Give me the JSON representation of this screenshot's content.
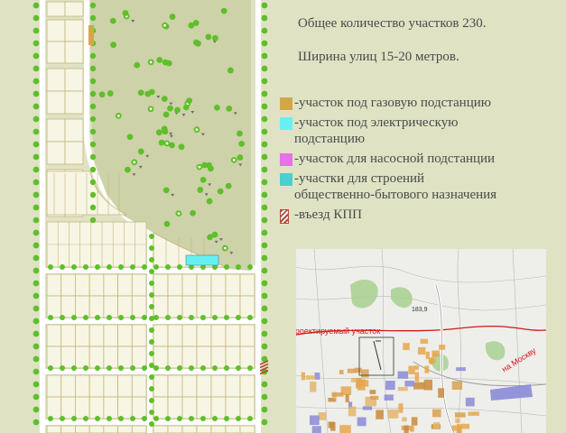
{
  "info": {
    "total_plots": "Общее количество участков 230.",
    "street_width": "Ширина улиц 15-20 метров."
  },
  "legend": [
    {
      "color": "#d4a64a",
      "kind": "fill",
      "label": "-участок под газовую подстанцию"
    },
    {
      "color": "#66f0f4",
      "kind": "fill",
      "label": "-участок под электрическую\nподстанцию"
    },
    {
      "color": "#e870e8",
      "kind": "fill",
      "label": "-участок для насосной подстанции"
    },
    {
      "color": "#4ad0d0",
      "kind": "fill",
      "label": "-участки для строений\nобщественно-бытового назначения"
    },
    {
      "color": "#b44a3a",
      "kind": "hatched",
      "label": "-въезд КПП"
    }
  ],
  "inset_map": {
    "label_planned": "проектируемый участок",
    "label_moscow": "на Москву",
    "label_number": "183,9"
  },
  "colors": {
    "background": "#dfe3c4",
    "plot_fill": "#f7f6e4",
    "plot_border": "#c3b57c",
    "road": "#ffffff",
    "tree": "#5fbf2a",
    "forest": "#cdd2a8"
  }
}
